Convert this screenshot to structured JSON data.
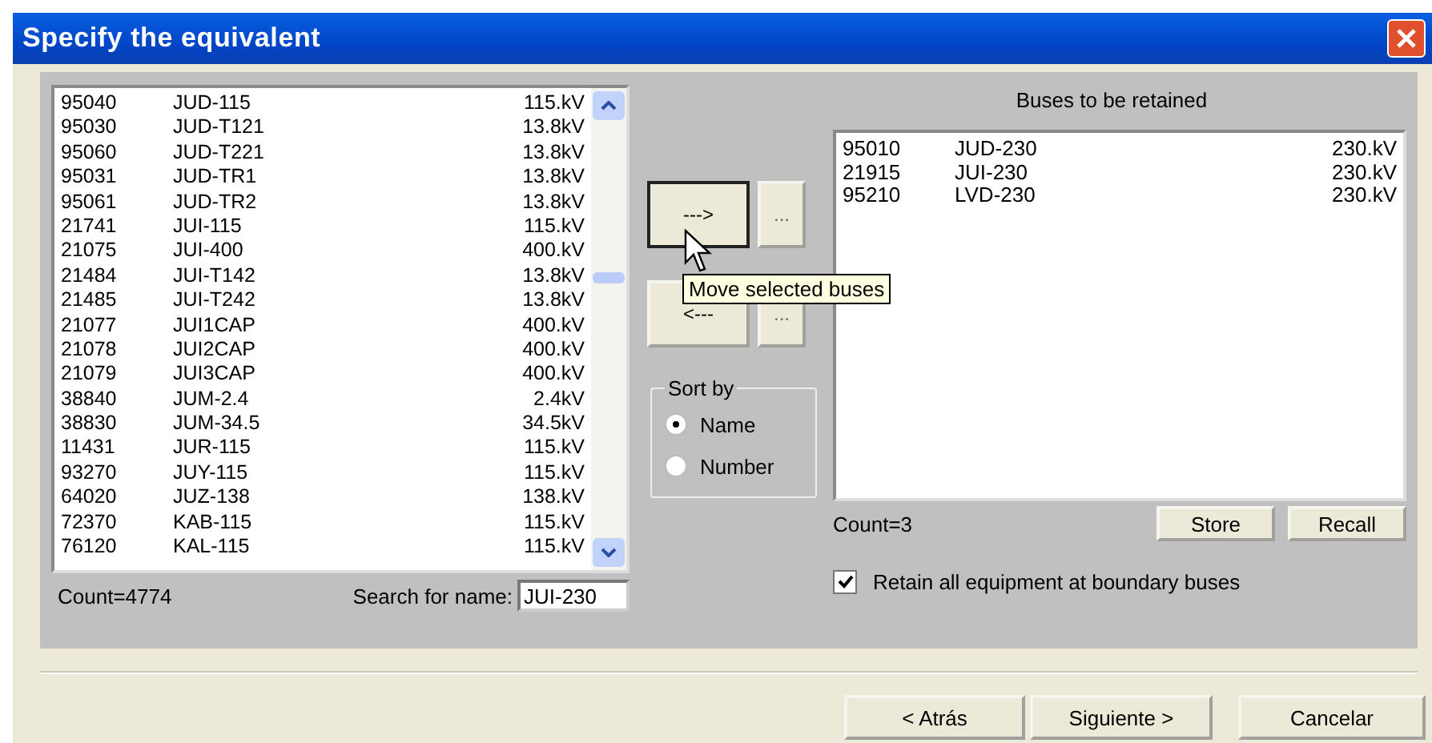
{
  "window": {
    "title": "Specify the equivalent"
  },
  "available": {
    "rows": [
      {
        "number": "95040",
        "name": "JUD-115",
        "voltage": "115.kV"
      },
      {
        "number": "95030",
        "name": "JUD-T121",
        "voltage": "13.8kV"
      },
      {
        "number": "95060",
        "name": "JUD-T221",
        "voltage": "13.8kV"
      },
      {
        "number": "95031",
        "name": "JUD-TR1",
        "voltage": "13.8kV"
      },
      {
        "number": "95061",
        "name": "JUD-TR2",
        "voltage": "13.8kV"
      },
      {
        "number": "21741",
        "name": "JUI-115",
        "voltage": "115.kV"
      },
      {
        "number": "21075",
        "name": "JUI-400",
        "voltage": "400.kV"
      },
      {
        "number": "21484",
        "name": "JUI-T142",
        "voltage": "13.8kV"
      },
      {
        "number": "21485",
        "name": "JUI-T242",
        "voltage": "13.8kV"
      },
      {
        "number": "21077",
        "name": "JUI1CAP",
        "voltage": "400.kV"
      },
      {
        "number": "21078",
        "name": "JUI2CAP",
        "voltage": "400.kV"
      },
      {
        "number": "21079",
        "name": "JUI3CAP",
        "voltage": "400.kV"
      },
      {
        "number": "38840",
        "name": "JUM-2.4",
        "voltage": "2.4kV"
      },
      {
        "number": "38830",
        "name": "JUM-34.5",
        "voltage": "34.5kV"
      },
      {
        "number": "11431",
        "name": "JUR-115",
        "voltage": "115.kV"
      },
      {
        "number": "93270",
        "name": "JUY-115",
        "voltage": "115.kV"
      },
      {
        "number": "64020",
        "name": "JUZ-138",
        "voltage": "138.kV"
      },
      {
        "number": "72370",
        "name": "KAB-115",
        "voltage": "115.kV"
      },
      {
        "number": "76120",
        "name": "KAL-115",
        "voltage": "115.kV"
      }
    ],
    "count": "Count=4774",
    "search_label": "Search for name:",
    "search_value": "JUI-230"
  },
  "transfer": {
    "move_right": "--->",
    "move_right_more": "...",
    "move_left": "<---",
    "move_left_more": "...",
    "tooltip": "Move selected buses"
  },
  "sort_by": {
    "title": "Sort by",
    "options": [
      {
        "label": "Name",
        "selected": true
      },
      {
        "label": "Number",
        "selected": false
      }
    ]
  },
  "retained": {
    "title": "Buses to be retained",
    "rows": [
      {
        "number": "95010",
        "name": "JUD-230",
        "voltage": "230.kV"
      },
      {
        "number": "21915",
        "name": "JUI-230",
        "voltage": "230.kV"
      },
      {
        "number": "95210",
        "name": "LVD-230",
        "voltage": "230.kV"
      }
    ],
    "count": "Count=3",
    "store": "Store",
    "recall": "Recall"
  },
  "retain_equipment": {
    "label": "Retain all equipment at boundary buses",
    "checked": true
  },
  "nav_buttons": [
    "< Atrás",
    "Siguiente >",
    "Cancelar"
  ]
}
